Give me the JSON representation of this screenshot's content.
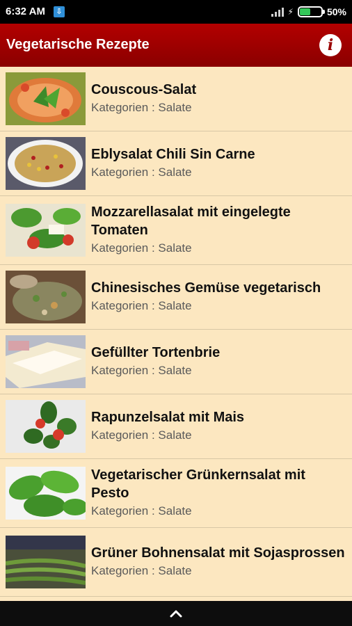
{
  "status": {
    "time": "6:32 AM",
    "notification_icon": "download-notification-icon",
    "battery_percent": "50%",
    "battery_level": 0.5,
    "charging": true
  },
  "appbar": {
    "title": "Vegetarische Rezepte",
    "info_icon": "info-icon"
  },
  "recipes": [
    {
      "title": "Couscous-Salat",
      "category": "Kategorien : Salate",
      "image": "couscous-salad-photo"
    },
    {
      "title": "Eblysalat Chili Sin Carne",
      "category": "Kategorien : Salate",
      "image": "ebly-salad-photo"
    },
    {
      "title": "Mozzarellasalat mit eingelegte Tomaten",
      "category": "Kategorien : Salate",
      "image": "mozzarella-salad-photo"
    },
    {
      "title": "Chinesisches Gemüse vegetarisch",
      "category": "Kategorien : Salate",
      "image": "chinese-vegetables-photo"
    },
    {
      "title": "Gefüllter Tortenbrie",
      "category": "Kategorien : Salate",
      "image": "brie-photo"
    },
    {
      "title": "Rapunzelsalat mit Mais",
      "category": "Kategorien : Salate",
      "image": "lambs-lettuce-photo"
    },
    {
      "title": "Vegetarischer Grünkernsalat mit Pesto",
      "category": "Kategorien : Salate",
      "image": "basil-photo"
    },
    {
      "title": "Grüner Bohnensalat mit Sojasprossen",
      "category": "Kategorien : Salate",
      "image": "green-beans-photo"
    }
  ],
  "navbar": {
    "icon": "chevron-up-icon"
  },
  "colors": {
    "appbar": "#a00000",
    "list_background": "#fce7c0",
    "divider": "#d7c7a5"
  }
}
